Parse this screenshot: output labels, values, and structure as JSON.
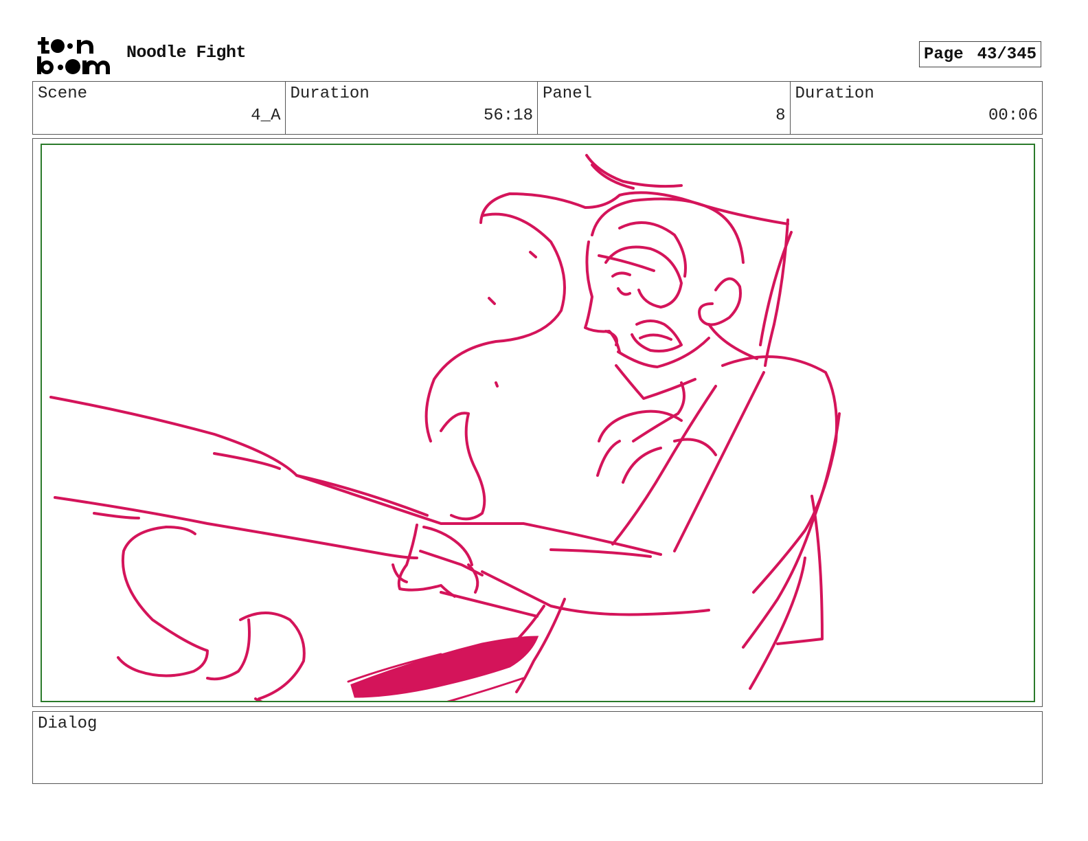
{
  "header": {
    "logo_text": "toon boom",
    "title": "Noodle Fight",
    "page_label": "Page",
    "page_value": "43/345"
  },
  "info": {
    "scene_label": "Scene",
    "scene_value": "4_A",
    "scene_duration_label": "Duration",
    "scene_duration_value": "56:18",
    "panel_label": "Panel",
    "panel_value": "8",
    "panel_duration_label": "Duration",
    "panel_duration_value": "00:06"
  },
  "panel": {
    "sketch_color": "#d4145a",
    "safe_area_color": "#2a7a2a"
  },
  "dialog": {
    "label": "Dialog",
    "text": ""
  }
}
